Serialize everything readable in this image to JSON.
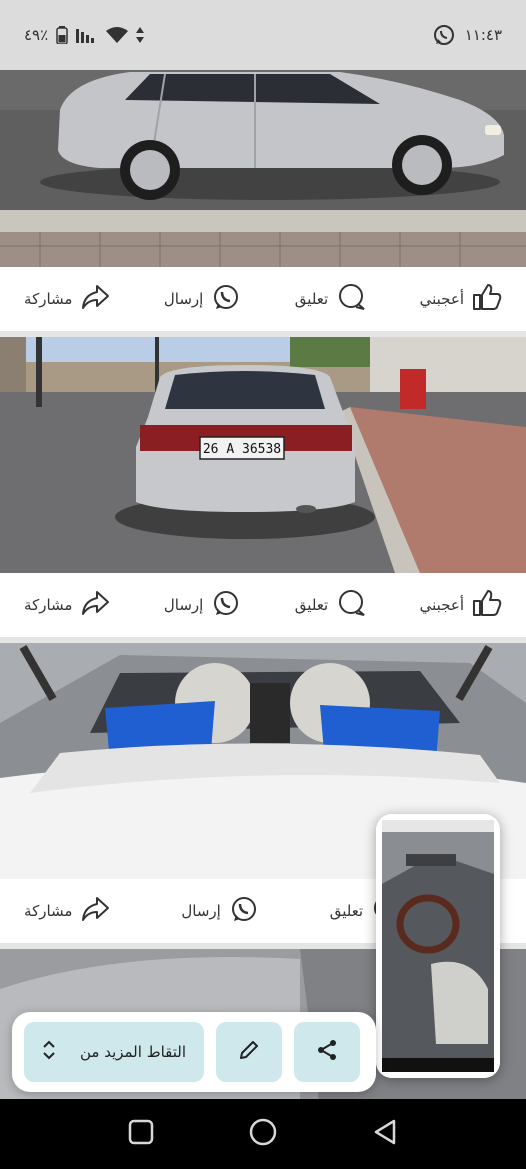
{
  "status_bar": {
    "time": "١١:٤٣",
    "battery": "٤٩٪",
    "icons": [
      "whatsapp-icon",
      "battery-icon",
      "signal-icon",
      "wifi-icon",
      "data-arrows-icon"
    ]
  },
  "posts": [
    {
      "actions": {
        "like": "أعجبني",
        "comment": "تعليق",
        "send": "إرسال",
        "share": "مشاركة"
      }
    },
    {
      "plate": "26 A 36538",
      "actions": {
        "like": "أعجبني",
        "comment": "تعليق",
        "send": "إرسال",
        "share": "مشاركة"
      }
    },
    {
      "actions": {
        "comment": "تعليق",
        "send": "إرسال",
        "share": "مشاركة"
      }
    }
  ],
  "toolbar": {
    "capture_more_label": "التقاط المزيد من",
    "icons": [
      "share-icon",
      "pencil-icon",
      "chevron-updown-icon"
    ]
  },
  "colors": {
    "toolbar_button": "#cfe8ec",
    "status_bar": "#dcdcdc",
    "nav_bar": "#000000"
  }
}
